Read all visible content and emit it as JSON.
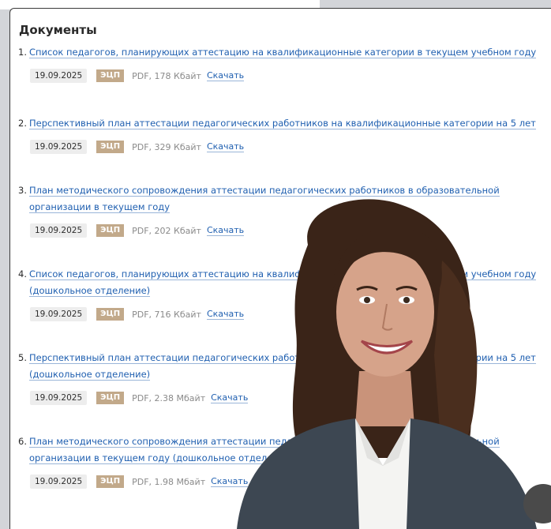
{
  "section_title": "Документы",
  "download_label": "Скачать",
  "badge_label": "ЭЦП",
  "documents": [
    {
      "num": "1.",
      "line1": "Список педагогов, планирующих аттестацию на квалификационные категории в текущем учебном году",
      "line2": "",
      "date": "19.09.2025",
      "size": "PDF, 178 Кбайт"
    },
    {
      "num": "2.",
      "line1": "Перспективный план аттестации педагогических работников на квалификационные категории на 5 лет",
      "line2": "",
      "date": "19.09.2025",
      "size": "PDF, 329 Кбайт"
    },
    {
      "num": "3.",
      "line1": "План методического сопровождения аттестации педагогических работников в образовательной",
      "line2": "организации в текущем году",
      "date": "19.09.2025",
      "size": "PDF, 202 Кбайт"
    },
    {
      "num": "4.",
      "line1": "Список педагогов, планирующих аттестацию на квалификационные категории в текущем учебном году",
      "line2": "(дошкольное отделение)",
      "date": "19.09.2025",
      "size": "PDF, 716 Кбайт"
    },
    {
      "num": "5.",
      "line1": "Перспективный план аттестации педагогических работников на квалификационные категории на 5 лет",
      "line2": "(дошкольное отделение)",
      "date": "19.09.2025",
      "size": "PDF, 2.38 Мбайт"
    },
    {
      "num": "6.",
      "line1": "План методического сопровождения аттестации педагогических работников в образовательной",
      "line2": "организации в текущем году (дошкольное отделение)",
      "date": "19.09.2025",
      "size": "PDF, 1.98 Мбайт"
    }
  ],
  "colors": {
    "link": "#1f5fb0",
    "badge": "#c2a98a",
    "background": "#d3d5d9"
  }
}
